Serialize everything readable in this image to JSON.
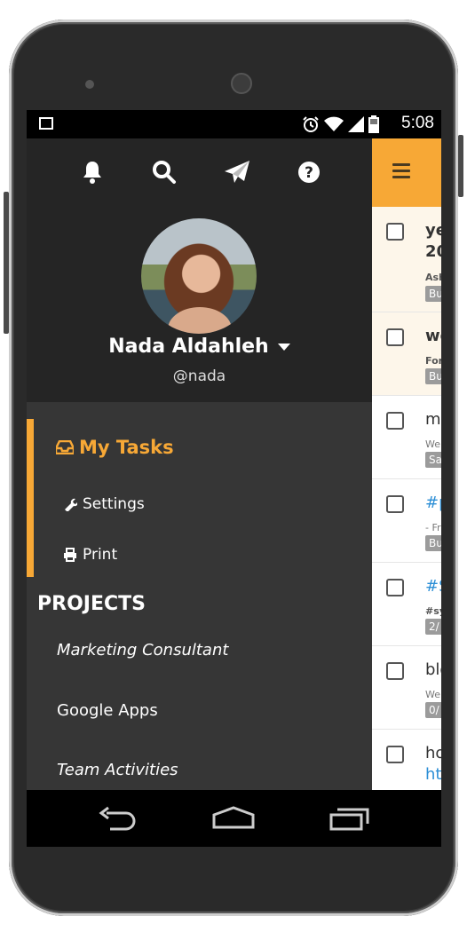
{
  "status_bar": {
    "time": "5:08"
  },
  "drawer": {
    "top_icons": [
      "bell-icon",
      "search-icon",
      "paper-plane-icon",
      "question-circle-icon"
    ],
    "user_name": "Nada Aldahleh",
    "user_handle": "@nada",
    "menu": {
      "my_tasks": "My Tasks",
      "settings": "Settings",
      "print": "Print"
    },
    "projects_heading": "PROJECTS",
    "projects": [
      "Marketing Consultant",
      "Google Apps",
      "Team Activities"
    ]
  },
  "task_list": {
    "rows": [
      {
        "title": "ye",
        "title2": "20",
        "sub": "Ash",
        "tag": "Bu"
      },
      {
        "title": "we",
        "sub": "For",
        "tag": "Bu"
      },
      {
        "title": "ma",
        "sub": "We",
        "tag": "Sa"
      },
      {
        "title": "#p",
        "sub": "- Fr",
        "tag": "Bu"
      },
      {
        "title": "#S",
        "sub": "#sy",
        "tag": "2/"
      },
      {
        "title": "blo",
        "sub": "We",
        "tag": "0/"
      },
      {
        "title": "ho",
        "title2": "ht"
      }
    ]
  },
  "colors": {
    "accent": "#f7a836",
    "drawer_bg": "#363636",
    "header_bg": "#252525"
  }
}
